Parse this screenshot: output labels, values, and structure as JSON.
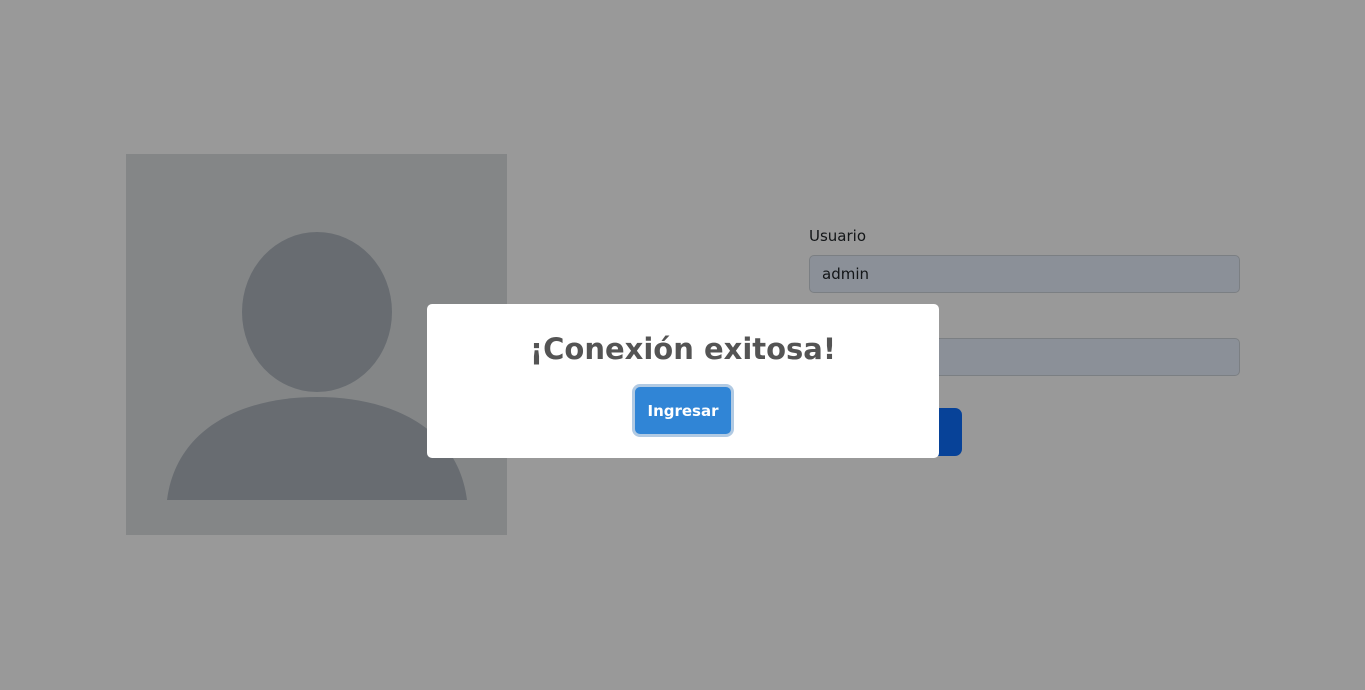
{
  "login": {
    "avatar_icon": "user-silhouette-icon",
    "username_label": "Usuario",
    "username_value": "admin",
    "password_label": "",
    "password_value": "",
    "submit_label": ""
  },
  "dialog": {
    "title": "¡Conexión exitosa!",
    "confirm_label": "Ingresar"
  },
  "colors": {
    "backdrop": "rgba(0,0,0,0.4)",
    "confirm_button": "#3085d6",
    "submit_button": "#0d6efd",
    "title_text": "#545454"
  }
}
